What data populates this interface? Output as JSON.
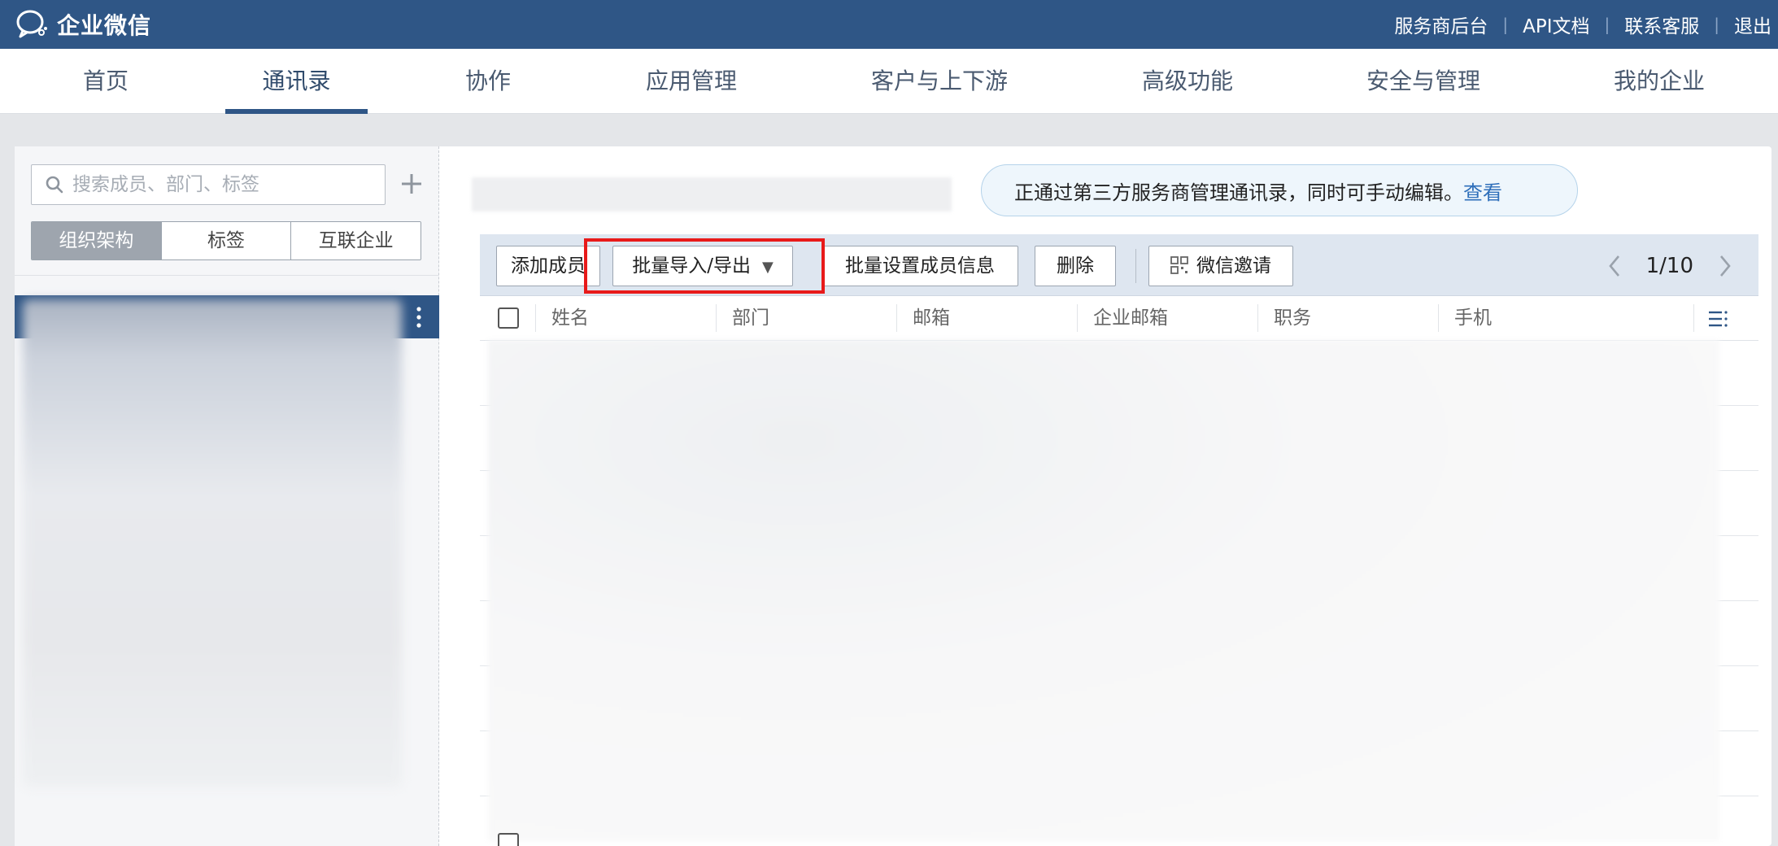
{
  "app": {
    "title": "企业微信"
  },
  "toplinks": [
    "服务商后台",
    "API文档",
    "联系客服",
    "退出"
  ],
  "nav": {
    "items": [
      "首页",
      "通讯录",
      "协作",
      "应用管理",
      "客户与上下游",
      "高级功能",
      "安全与管理",
      "我的企业"
    ],
    "active": "通讯录"
  },
  "sidebar": {
    "search_placeholder": "搜索成员、部门、标签",
    "segments": [
      "组织架构",
      "标签",
      "互联企业"
    ],
    "active_segment": "组织架构"
  },
  "notice": {
    "text": "正通过第三方服务商管理通讯录，同时可手动编辑。",
    "link": "查看"
  },
  "toolbar": {
    "add_member": "添加成员",
    "batch_import_export": "批量导入/导出",
    "batch_set_info": "批量设置成员信息",
    "delete": "删除",
    "wechat_invite": "微信邀请"
  },
  "pager": {
    "text": "1/10"
  },
  "table": {
    "columns": [
      "姓名",
      "部门",
      "邮箱",
      "企业邮箱",
      "职务",
      "手机"
    ]
  },
  "colors": {
    "topbar": "#2f5686",
    "highlight": "#e81a1a",
    "link": "#2f6fba"
  }
}
